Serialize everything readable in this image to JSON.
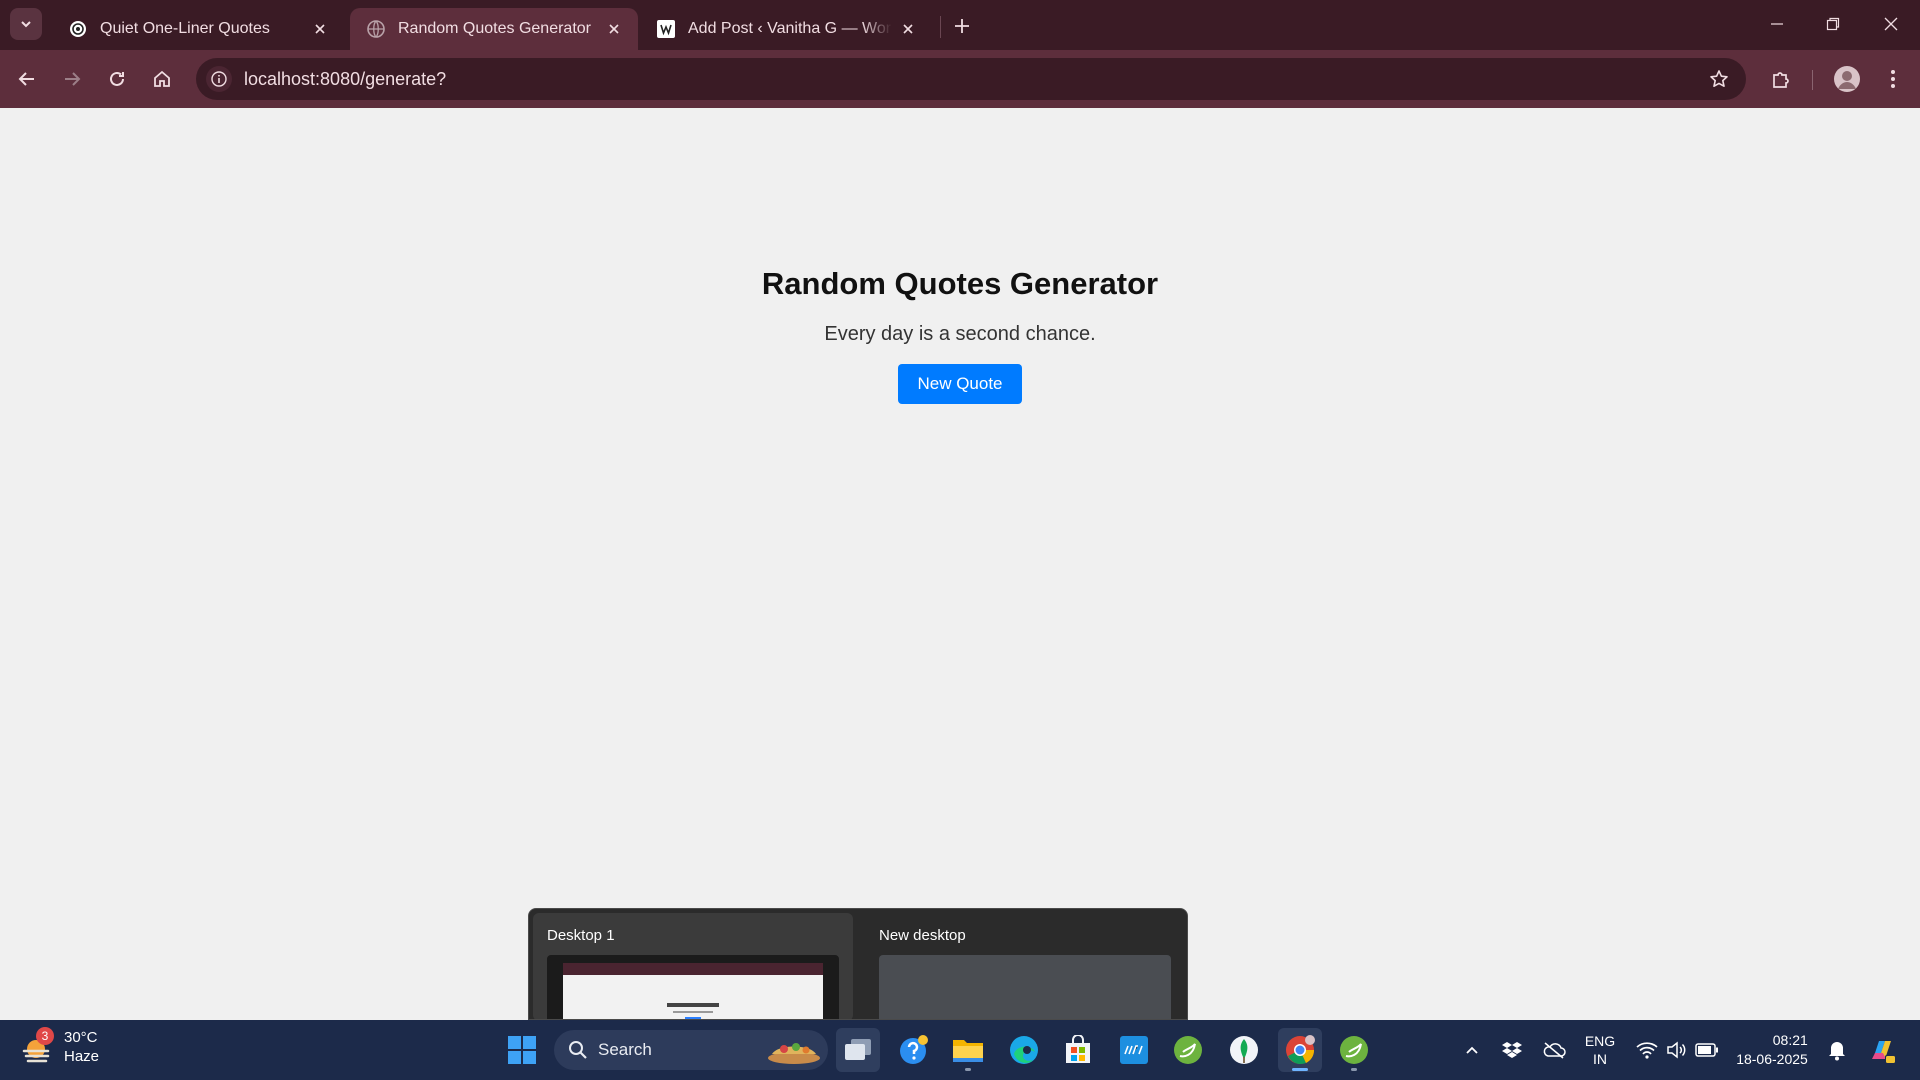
{
  "browser": {
    "tabs": [
      {
        "title": "Quiet One-Liner Quotes",
        "active": false
      },
      {
        "title": "Random Quotes Generator",
        "active": true
      },
      {
        "title": "Add Post ‹ Vanitha G — WordPress",
        "active": false
      }
    ],
    "url": "localhost:8080/generate?"
  },
  "page": {
    "title": "Random Quotes Generator",
    "quote": "Every day is a second chance.",
    "button_label": "New Quote",
    "button_color": "#007bff"
  },
  "task_view": {
    "desktops": [
      {
        "label": "Desktop 1"
      },
      {
        "label": "New desktop"
      }
    ]
  },
  "taskbar": {
    "weather": {
      "temp": "30°C",
      "condition": "Haze",
      "badge": "3"
    },
    "search_label": "Search",
    "apps": [
      "task-view-icon",
      "help-icon",
      "file-explorer-icon",
      "edge-icon",
      "store-icon",
      "myhp-icon",
      "spring-tools-icon",
      "mongodb-icon",
      "chrome-icon",
      "spring-tools-icon"
    ],
    "language": {
      "line1": "ENG",
      "line2": "IN"
    },
    "time": "08:21",
    "date": "18-06-2025"
  },
  "colors": {
    "tab_strip": "#3a1b25",
    "toolbar": "#5d2e3c",
    "taskbar": "#1c2a4a",
    "page_bg": "#f0f0f0"
  }
}
